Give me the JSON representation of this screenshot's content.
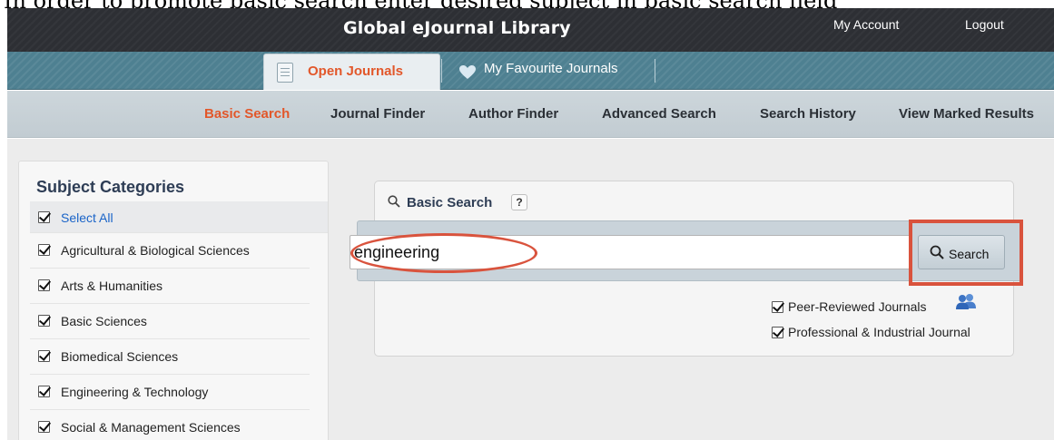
{
  "caption": "In order to promote basic search enter desired subject in basic search field",
  "header": {
    "brand": "Global eJournal Library",
    "my_account": "My Account",
    "logout": "Logout"
  },
  "tabs": [
    {
      "label": "Open Journals",
      "icon": "document-icon",
      "active": true
    },
    {
      "label": "My Favourite Journals",
      "icon": "heart-icon",
      "active": false
    }
  ],
  "subnav": [
    {
      "label": "Basic Search",
      "active": true
    },
    {
      "label": "Journal Finder"
    },
    {
      "label": "Author Finder"
    },
    {
      "label": "Advanced Search"
    },
    {
      "label": "Search History"
    },
    {
      "label": "View Marked Results"
    }
  ],
  "sidebar": {
    "title": "Subject Categories",
    "items": [
      {
        "label": "Select All",
        "checked": true
      },
      {
        "label": "Agricultural & Biological Sciences",
        "checked": true
      },
      {
        "label": "Arts & Humanities",
        "checked": true
      },
      {
        "label": "Basic Sciences",
        "checked": true
      },
      {
        "label": "Biomedical Sciences",
        "checked": true
      },
      {
        "label": "Engineering & Technology",
        "checked": true
      },
      {
        "label": "Social & Management Sciences",
        "checked": true
      }
    ]
  },
  "search": {
    "title": "Basic Search",
    "help": "?",
    "query": "engineering",
    "button_label": "Search",
    "options": [
      {
        "label": "Peer-Reviewed Journals",
        "checked": true,
        "icon": "people-icon"
      },
      {
        "label": "Professional & Industrial Journal",
        "checked": true
      }
    ]
  },
  "colors": {
    "accent": "#e2572a",
    "header_bg": "#2d2f34",
    "tab_strip": "#4e8091",
    "annotation": "#d9533d"
  }
}
